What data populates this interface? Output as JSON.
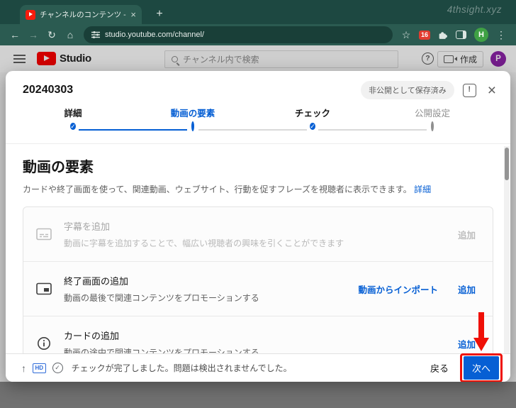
{
  "icons": {
    "close": "×",
    "plus": "+",
    "back": "←",
    "forward": "→",
    "refresh": "↻",
    "home": "⌂",
    "star": "☆",
    "menu": "⋮",
    "help": "?",
    "feedback": "!",
    "check": "✓",
    "upload": "↑"
  },
  "browser": {
    "tab_title": "チャンネルのコンテンツ - YouTube S",
    "url": "studio.youtube.com/channel/",
    "extension_badge": "16",
    "profile_initial": "H",
    "watermark": "4thsight.xyz"
  },
  "studio_header": {
    "logo_text": "Studio",
    "search_placeholder": "チャンネル内で検索",
    "create_label": "作成",
    "avatar_initial": "P"
  },
  "dialog": {
    "title": "20240303",
    "saved_badge": "非公開として保存済み",
    "steps": [
      {
        "label": "詳細",
        "state": "completed"
      },
      {
        "label": "動画の要素",
        "state": "current"
      },
      {
        "label": "チェック",
        "state": "completed"
      },
      {
        "label": "公開設定",
        "state": "upcoming"
      }
    ],
    "heading": "動画の要素",
    "description": "カードや終了画面を使って、関連動画、ウェブサイト、行動を促すフレーズを視聴者に表示できます。",
    "description_link": "詳細",
    "rows": [
      {
        "title": "字幕を追加",
        "description": "動画に字幕を追加することで、幅広い視聴者の興味を引くことができます",
        "action": "追加",
        "disabled": true
      },
      {
        "title": "終了画面の追加",
        "description": "動画の最後で関連コンテンツをプロモーションする",
        "import_action": "動画からインポート",
        "action": "追加",
        "disabled": false
      },
      {
        "title": "カードの追加",
        "description": "動画の途中で関連コンテンツをプロモーションする",
        "action": "追加",
        "disabled": false
      }
    ],
    "footer": {
      "hd_label": "HD",
      "status": "チェックが完了しました。問題は検出されませんでした。",
      "back_label": "戻る",
      "next_label": "次へ"
    }
  },
  "colors": {
    "accent_blue": "#065fd4",
    "annotation_red": "#ef1007",
    "chrome_theme_teal": "#2b5b51",
    "youtube_red": "#ff0000",
    "avatar_green": "#3fa144",
    "avatar_purple": "#8e24aa"
  }
}
